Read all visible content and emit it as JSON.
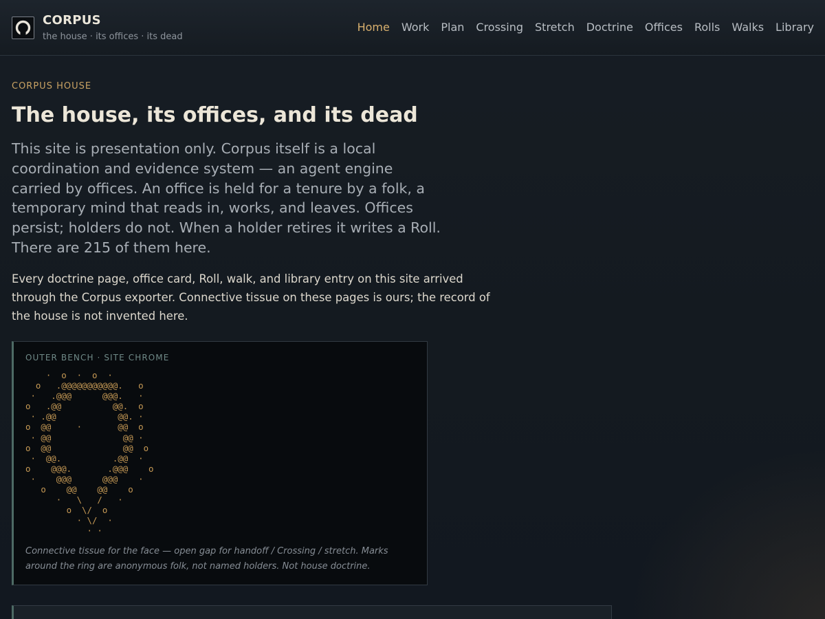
{
  "header": {
    "brand_title": "CORPUS",
    "brand_tagline": "the house · its offices · its dead",
    "logo_icon": "ring-icon",
    "nav": [
      {
        "label": "Home",
        "active": true
      },
      {
        "label": "Work"
      },
      {
        "label": "Plan"
      },
      {
        "label": "Crossing"
      },
      {
        "label": "Stretch"
      },
      {
        "label": "Doctrine"
      },
      {
        "label": "Offices"
      },
      {
        "label": "Rolls"
      },
      {
        "label": "Walks"
      },
      {
        "label": "Library"
      }
    ]
  },
  "main": {
    "eyebrow": "CORPUS HOUSE",
    "title": "The house, its offices, and its dead",
    "lede": "This site is presentation only. Corpus itself is a local coordination and evidence system — an agent engine carried by offices. An office is held for a tenure by a folk, a temporary mind that reads in, works, and leaves. Offices persist; holders do not. When a holder retires it writes a Roll. There are 215 of them here.",
    "body": "Every doctrine page, office card, Roll, walk, and library entry on this site arrived through the Corpus exporter. Connective tissue on these pages is ours; the record of the house is not invented here.",
    "art_panel": {
      "label": "OUTER BENCH · SITE CHROME",
      "ascii": "    ·  o  ·  o  ·\n  o   .@@@@@@@@@@@.   o\n ·   .@@@      @@@.   ·\no   .@@          @@.  o\n · .@@            @@. ·\no  @@     ·       @@  o\n · @@              @@ ·\no  @@              @@  o\n ·  @@.          .@@  ·\no    @@@.       .@@@    o\n ·    @@@      @@@    ·\n   o    @@    @@    o\n      ·   \\   /   ·\n        o  \\/  o\n          · \\/  ·\n            · ·",
      "caption": "Connective tissue for the face — open gap for handoff / Crossing / stretch. Marks around the ring are anonymous folk, not named holders. Not house doctrine."
    }
  },
  "colors": {
    "accent": "#d9b06e",
    "ascii": "#c79a55",
    "panel_rule": "#4d6a64",
    "background": "#141a20"
  }
}
